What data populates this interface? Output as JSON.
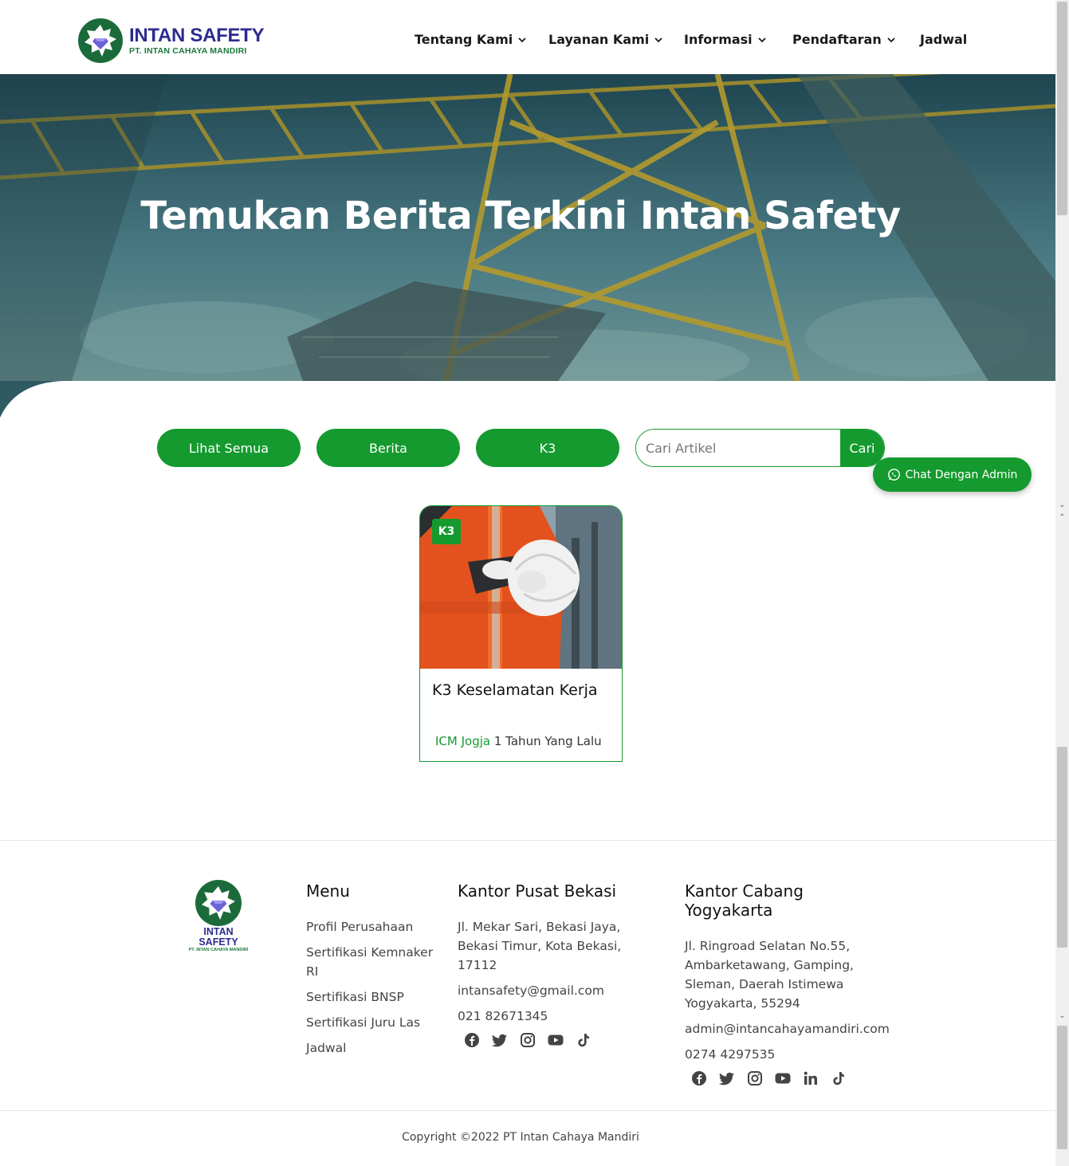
{
  "brand": {
    "title": "INTAN SAFETY",
    "subtitle": "PT. INTAN CAHAYA MANDIRI",
    "colors": {
      "primary_green": "#149a2e",
      "brand_blue": "#2d2b8f",
      "badge_green": "#1b6b3a"
    }
  },
  "nav": {
    "items": [
      {
        "label": "Tentang Kami",
        "dropdown": true
      },
      {
        "label": "Layanan Kami",
        "dropdown": true
      },
      {
        "label": "Informasi",
        "dropdown": true
      },
      {
        "label": "Pendaftaran",
        "dropdown": true
      },
      {
        "label": "Jadwal",
        "dropdown": false
      }
    ]
  },
  "hero": {
    "title": "Temukan Berita Terkini Intan Safety"
  },
  "filters": {
    "buttons": [
      "Lihat Semua",
      "Berita",
      "K3"
    ],
    "search": {
      "placeholder": "Cari Artikel",
      "value": "",
      "button_label": "Cari"
    }
  },
  "chat": {
    "label": "Chat Dengan Admin",
    "icon": "whatsapp-icon"
  },
  "articles": [
    {
      "tag": "K3",
      "title": "K3 Keselamatan Kerja",
      "author": "ICM Jogja",
      "time": "1 Tahun Yang Lalu"
    }
  ],
  "footer": {
    "logo_title": "INTAN SAFETY",
    "logo_subtitle": "PT. INTAN CAHAYA MANDIRI",
    "menu": {
      "heading": "Menu",
      "items": [
        "Profil Perusahaan",
        "Sertifikasi Kemnaker RI",
        "Sertifikasi BNSP",
        "Sertifikasi Juru Las",
        "Jadwal"
      ]
    },
    "pusat": {
      "heading": "Kantor Pusat Bekasi",
      "address": "Jl. Mekar Sari, Bekasi Jaya, Bekasi Timur, Kota Bekasi, 17112",
      "email": "intansafety@gmail.com",
      "phone": "021 82671345",
      "socials": [
        "facebook-icon",
        "twitter-icon",
        "instagram-icon",
        "youtube-icon",
        "tiktok-icon"
      ]
    },
    "cabang": {
      "heading": "Kantor Cabang Yogyakarta",
      "address": "Jl. Ringroad Selatan No.55, Ambarketawang, Gamping, Sleman, Daerah Istimewa Yogyakarta, 55294",
      "email": "admin@intancahayamandiri.com",
      "phone": "0274 4297535",
      "socials": [
        "facebook-icon",
        "twitter-icon",
        "instagram-icon",
        "youtube-icon",
        "linkedin-icon",
        "tiktok-icon"
      ]
    },
    "copyright": "Copyright ©2022 PT Intan Cahaya Mandiri"
  }
}
